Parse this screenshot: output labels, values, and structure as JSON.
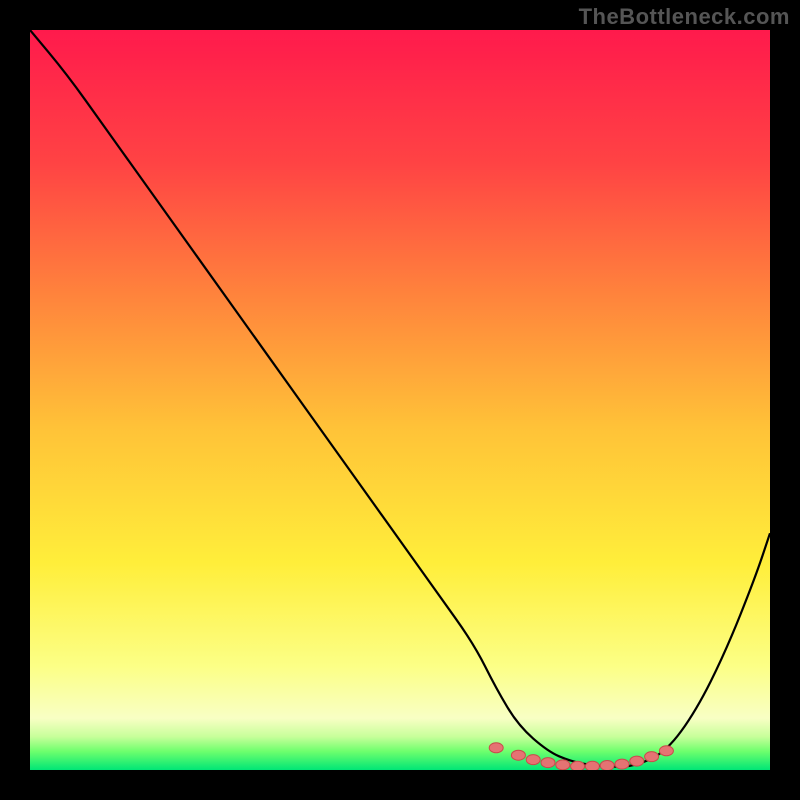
{
  "watermark": "TheBottleneck.com",
  "colors": {
    "frame_bg": "#000000",
    "grad_top": "#ff1a4c",
    "grad_mid1": "#ff6a3a",
    "grad_mid2": "#ffb638",
    "grad_mid3": "#ffe93a",
    "grad_mid4": "#fdff70",
    "grad_low": "#faffb8",
    "grad_green1": "#8eff6a",
    "grad_green2": "#00e676",
    "curve_stroke": "#000000",
    "marker_fill": "#e57373",
    "marker_stroke": "#c94b4b"
  },
  "chart_data": {
    "type": "line",
    "title": "",
    "xlabel": "",
    "ylabel": "",
    "xlim": [
      0,
      100
    ],
    "ylim": [
      0,
      100
    ],
    "grid": false,
    "series": [
      {
        "name": "bottleneck-curve",
        "x": [
          0,
          5,
          10,
          15,
          20,
          25,
          30,
          35,
          40,
          45,
          50,
          55,
          60,
          63,
          66,
          70,
          73,
          76,
          79,
          82,
          86,
          90,
          94,
          98,
          100
        ],
        "values": [
          100,
          94,
          87,
          80,
          73,
          66,
          59,
          52,
          45,
          38,
          31,
          24,
          17,
          11,
          6,
          2.5,
          1.2,
          0.6,
          0.4,
          0.6,
          2.5,
          8,
          16,
          26,
          32
        ]
      }
    ],
    "markers": {
      "name": "valley-points",
      "x": [
        63,
        66,
        68,
        70,
        72,
        74,
        76,
        78,
        80,
        82,
        84,
        86
      ],
      "values": [
        3.0,
        2.0,
        1.4,
        1.0,
        0.7,
        0.5,
        0.5,
        0.6,
        0.8,
        1.2,
        1.8,
        2.6
      ]
    },
    "gradient_stops": [
      {
        "offset": 0.0,
        "color": "#ff1a4c"
      },
      {
        "offset": 0.18,
        "color": "#ff4344"
      },
      {
        "offset": 0.36,
        "color": "#ff843c"
      },
      {
        "offset": 0.54,
        "color": "#ffc338"
      },
      {
        "offset": 0.72,
        "color": "#ffee3a"
      },
      {
        "offset": 0.86,
        "color": "#fcff86"
      },
      {
        "offset": 0.93,
        "color": "#f8ffc4"
      },
      {
        "offset": 0.955,
        "color": "#c7ff9a"
      },
      {
        "offset": 0.975,
        "color": "#6dff6d"
      },
      {
        "offset": 1.0,
        "color": "#00e676"
      }
    ]
  }
}
